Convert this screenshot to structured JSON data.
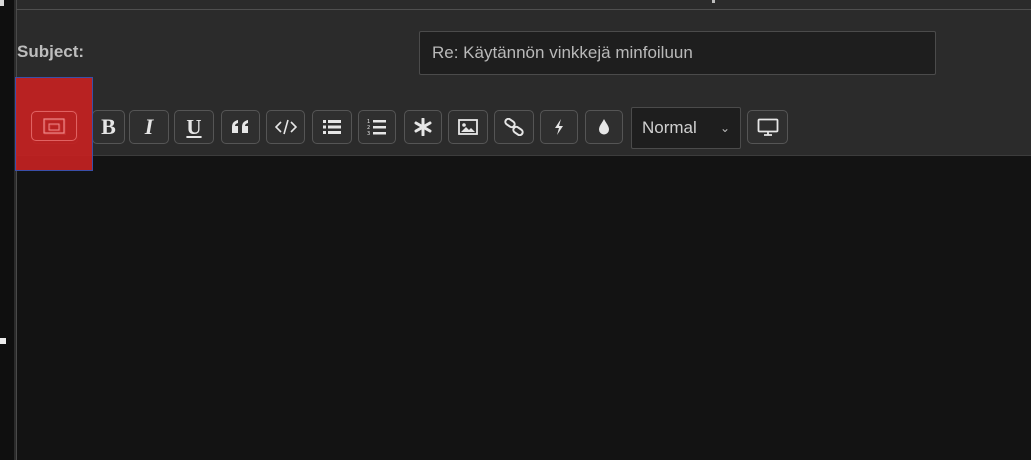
{
  "form": {
    "subject_label": "Subject:",
    "subject_value": "Re: Käytännön vinkkejä minfoiluun"
  },
  "toolbar": {
    "buttons": [
      {
        "name": "bbcode-toggle-button",
        "icon": "bbcode-icon"
      },
      {
        "name": "bold-button",
        "label": "B"
      },
      {
        "name": "italic-button",
        "label": "I"
      },
      {
        "name": "underline-button",
        "label": "U"
      },
      {
        "name": "quote-button",
        "icon": "quote-icon"
      },
      {
        "name": "code-button",
        "icon": "code-icon"
      },
      {
        "name": "bullet-list-button",
        "icon": "list-icon"
      },
      {
        "name": "numbered-list-button",
        "icon": "numbered-list-icon"
      },
      {
        "name": "list-item-button",
        "icon": "asterisk-icon"
      },
      {
        "name": "image-button",
        "icon": "image-icon"
      },
      {
        "name": "link-button",
        "icon": "link-icon"
      },
      {
        "name": "flash-button",
        "icon": "bolt-icon"
      },
      {
        "name": "color-button",
        "icon": "droplet-icon"
      }
    ],
    "font_size_select": "Normal",
    "preview_button_icon": "monitor-icon"
  },
  "colors": {
    "background": "#2b2b2b",
    "editor_background": "#131313",
    "highlight": "#c42222"
  }
}
